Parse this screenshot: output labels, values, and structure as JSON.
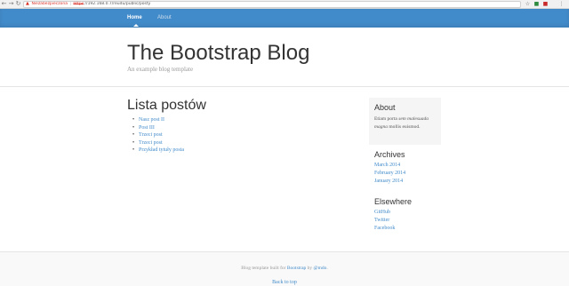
{
  "browser": {
    "back_icon": "arrow-left-icon",
    "forward_icon": "arrow-right-icon",
    "reload_icon": "reload-icon",
    "security_warning": "Niezabezpieczona",
    "url_scheme": "https",
    "url_rest": "://192.168.0.7/reudu/public/posty",
    "bookmark_icon": "star-icon",
    "menu_icon": "kebab-menu-icon"
  },
  "nav": {
    "home_label": "Home",
    "about_label": "About"
  },
  "header": {
    "title": "The Bootstrap Blog",
    "description": "An example blog template"
  },
  "main": {
    "title": "Lista postów",
    "posts": [
      "Nasz post II",
      "Post III",
      "Trzeci post",
      "Trzeci post",
      "Przykład tytuły posta"
    ]
  },
  "sidebar": {
    "about_title": "About",
    "about_text_1": "Etiam porta ",
    "about_text_em": "sem malesuada magna",
    "about_text_2": " mollis euismod.",
    "archives_title": "Archives",
    "archives": [
      "March 2014",
      "February 2014",
      "January 2014"
    ],
    "elsewhere_title": "Elsewhere",
    "elsewhere": [
      "GitHub",
      "Twitter",
      "Facebook"
    ]
  },
  "footer": {
    "text_1": "Blog template built for ",
    "bootstrap_link": "Bootstrap",
    "text_2": " by ",
    "author_link": "@mdo",
    "text_3": ".",
    "back_to_top": "Back to top"
  },
  "colors": {
    "masthead": "#428bca",
    "link": "#428bca"
  }
}
